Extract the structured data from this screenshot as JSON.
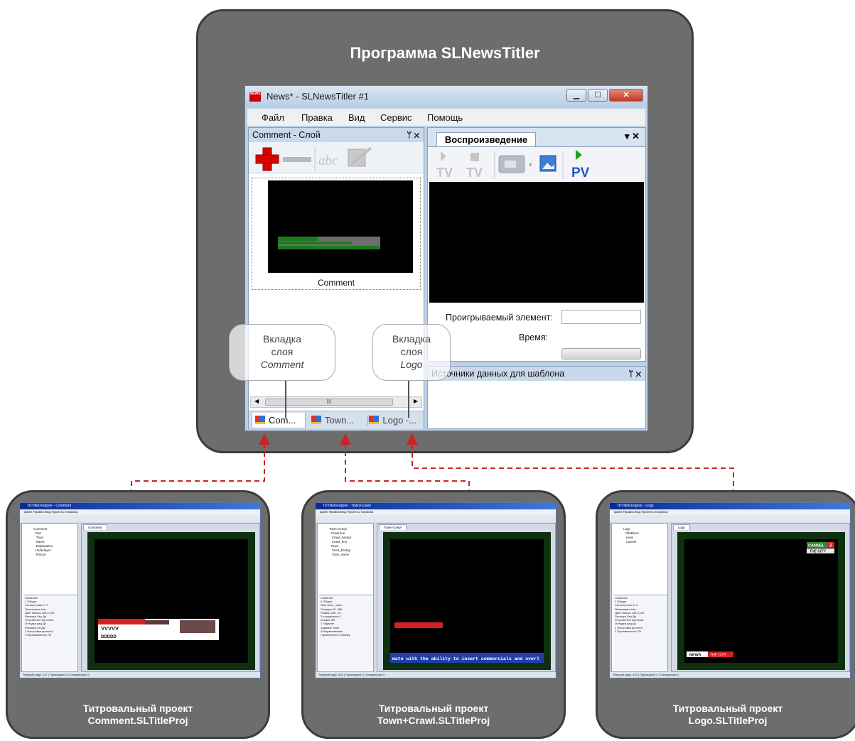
{
  "diagram_title": "Программа SLNewsTitler",
  "app": {
    "icon_text": "NEWS",
    "window_title": "News* - SLNewsTitler #1",
    "menu": [
      "Файл",
      "Правка",
      "Вид",
      "Сервис",
      "Помощь"
    ],
    "layer_pane_title": "Comment - Слой",
    "pin_close": "ᛘ ✕",
    "toolbar_text": "abc",
    "preview_caption": "Comment",
    "scroll_mark": "III",
    "layer_tabs": [
      "Com...",
      "Town...",
      "Logo -..."
    ],
    "playback_tab": "Воспроизведение",
    "playback_ctl": "▾ ✕",
    "playback_buttons": [
      "TV",
      "TV",
      "PV"
    ],
    "playing_label": "Проигрываемый элемент:",
    "time_label": "Время:",
    "sources_title": "Источники данных для шаблона"
  },
  "callouts": {
    "comment": {
      "line1": "Вкладка",
      "line2": "слоя",
      "line3": "Comment"
    },
    "logo": {
      "line1": "Вкладка",
      "line2": "слоя",
      "line3": "Logo"
    }
  },
  "projects": [
    {
      "caption_line1": "Титровальный проект",
      "caption_line2": "Comment.SLTitleProj",
      "window_title": "TDTitleDesigner - Comment",
      "tab": "Comment",
      "overlay": [
        "VVVVV",
        "DDDDD"
      ]
    },
    {
      "caption_line1": "Титровальный проект",
      "caption_line2": "Town+Crawl.SLTitleProj",
      "window_title": "TDTitleDesigner - Town+Crawl",
      "tab": "Town+Crawl",
      "overlay": [
        "mate with the ability to insert commercials and overl"
      ]
    },
    {
      "caption_line1": "Титровальный проект",
      "caption_line2": "Logo.SLTitleProj",
      "window_title": "TDTitleDesigner - Logo",
      "tab": "Logo",
      "overlay": [
        "CANNEL",
        "2",
        "THE CITY",
        "NEWS",
        "THE CITY"
      ]
    }
  ],
  "colors": {
    "panel": "#6d6d6d",
    "connector": "#cc2222",
    "accent_green": "#1f7a1f"
  }
}
